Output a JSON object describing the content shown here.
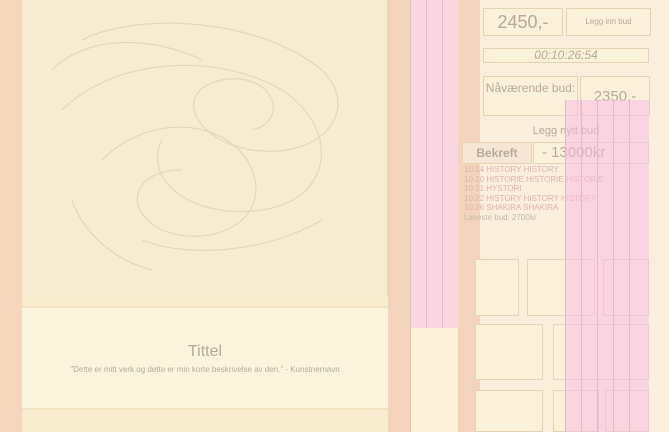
{
  "artwork": {
    "title": "Tittel",
    "description": "\"Dette er mitt verk og dette er min korte beskrivelse av den.\" - Kunstnernavn"
  },
  "auction": {
    "price": "2450,-",
    "low_bid_button": "Legg inn bud",
    "timer": "00:10:26:54",
    "current_bid_label": "Nåværende bud:",
    "current_bid_value": "2350,-",
    "new_bid_title": "Legg nytt bud",
    "confirm_button": "Bekreft",
    "bid_input_value": "- 13000kr"
  },
  "history": {
    "entries": [
      "10:14  HISTORY HISTORY",
      "10:20  HISTORIE HISTORIE  HISTORIE",
      "10:21  HYSTORI",
      "10:22  HISTORY HISTORY HISTORY",
      "10:26  SHAKIRA SHAKIRA"
    ],
    "latest": "Laveste bud: 2700kr"
  },
  "colors": {
    "accent_pink": "#f8d6e0",
    "panel_bg": "#fbefdc",
    "artwork_bg": "#f5ecd2"
  }
}
